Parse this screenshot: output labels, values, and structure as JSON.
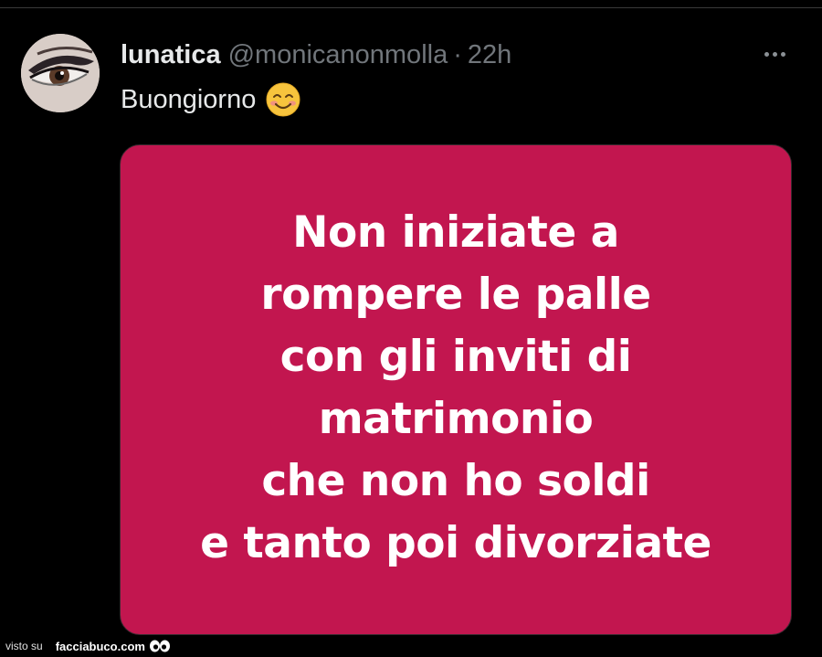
{
  "tweet": {
    "display_name": "lunatica",
    "handle": "@monicanonmolla",
    "separator": "·",
    "timestamp": "22h",
    "text": "Buongiorno",
    "emoji": "smiling-face-with-smiling-eyes-icon",
    "avatar": "avatar-eye-closeup"
  },
  "media": {
    "background_color": "#c2164f",
    "text_color": "#ffffff",
    "lines": [
      "Non iniziate a",
      "rompere le palle",
      "con gli inviti di",
      "matrimonio",
      "che non ho soldi",
      "e tanto poi divorziate"
    ]
  },
  "watermark": {
    "prefix": "visto su",
    "site": "facciabuco.com",
    "icon": "eyes-icon"
  },
  "colors": {
    "background": "#000000",
    "primary_text": "#e7e9ea",
    "secondary_text": "#71767b"
  }
}
